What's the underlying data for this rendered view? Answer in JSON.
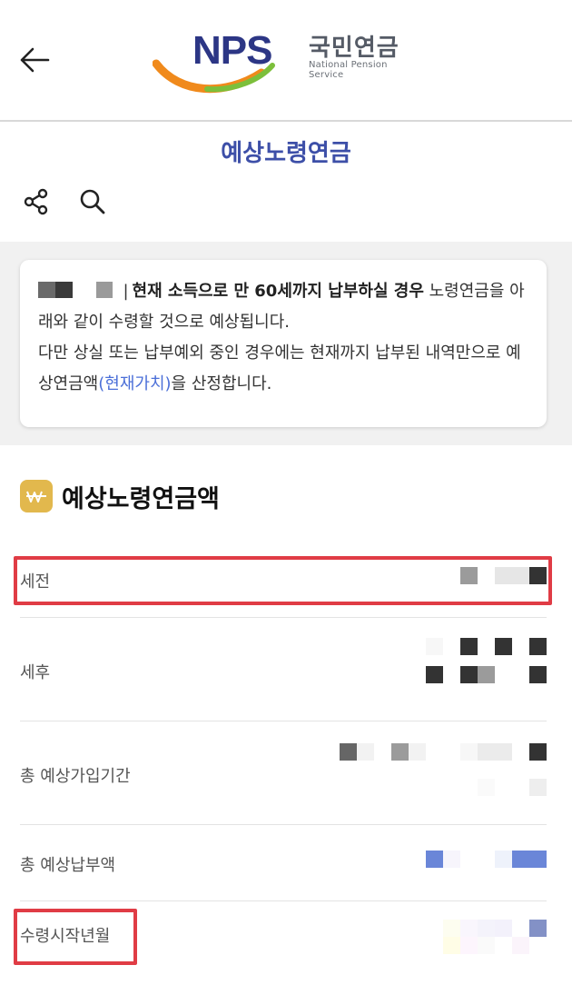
{
  "header": {
    "back_icon": "arrow-left-icon",
    "logo_letters": "NPS",
    "logo_korean": "국민연금",
    "logo_english": "National Pension Service",
    "brand_colors": {
      "navy": "#2c3685",
      "orange": "#f08a1c",
      "green": "#7cbf3b"
    }
  },
  "page": {
    "title": "예상노령연금"
  },
  "toolbar": {
    "share_icon": "share-icon",
    "search_icon": "search-icon"
  },
  "notice": {
    "separator": "|",
    "bold_text": "현재 소득으로 만 60세까지 납부하실 경우",
    "text_1": " 노령연금을 아래와 같이 수령할 것으로 예상됩니다.",
    "text_2": "다만 상실 또는 납부예외 중인 경우에는 현재까지 납부된 내역만으로 예상연금액",
    "link_text": "(현재가치)",
    "text_3": "을 산정합니다."
  },
  "section": {
    "icon": "won-icon",
    "title": "예상노령연금액"
  },
  "rows": [
    {
      "label": "세전"
    },
    {
      "label": "세후"
    },
    {
      "label": "총 예상가입기간"
    },
    {
      "label": "총 예상납부액"
    },
    {
      "label": "수령시작년월"
    }
  ],
  "colors": {
    "title_blue": "#3d4fa8",
    "link_blue": "#4b6fd8",
    "highlight_red": "#e03c45",
    "won_icon_gold": "#e2b84d"
  }
}
